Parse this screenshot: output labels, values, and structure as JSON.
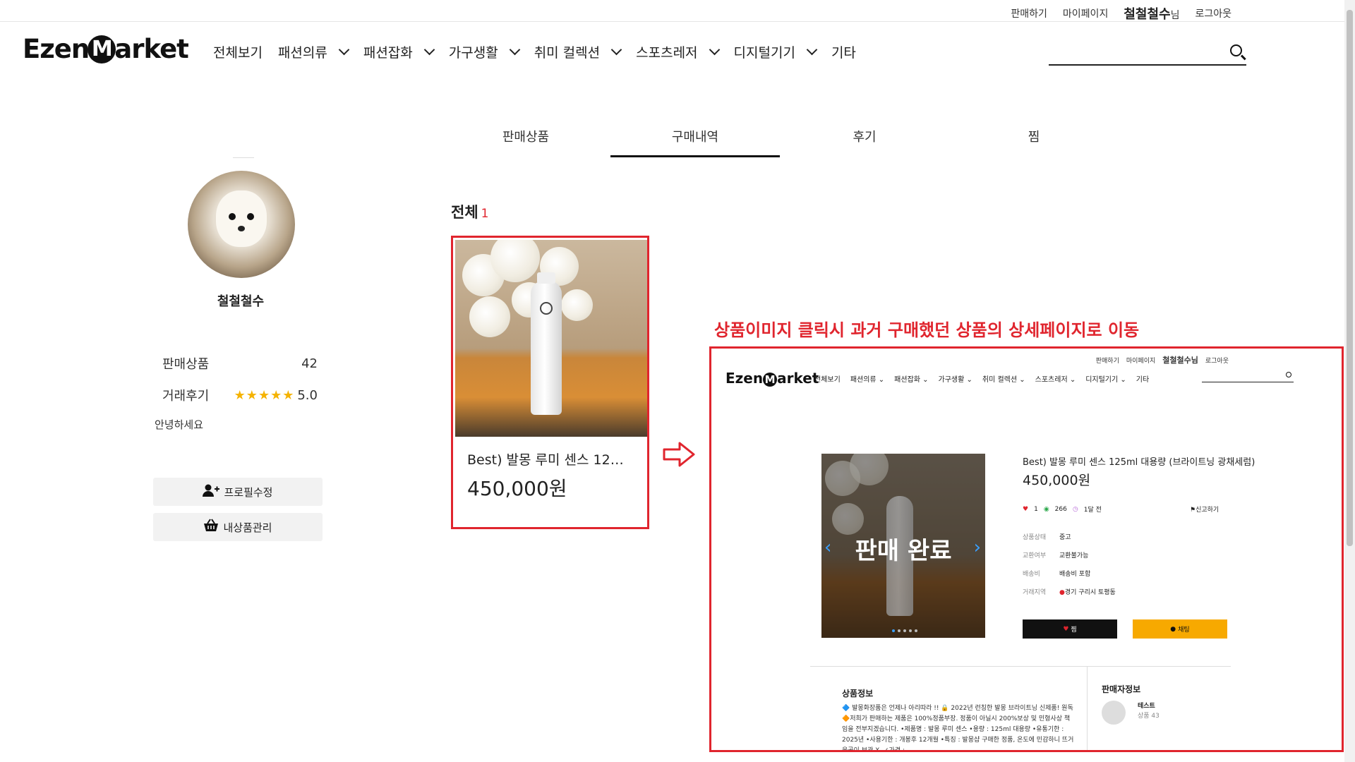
{
  "topbar": {
    "sell": "판매하기",
    "mypage": "마이페이지",
    "username": "철철철수",
    "nim": "님",
    "logout": "로그아웃"
  },
  "header": {
    "logo": {
      "pre": "Ezen",
      "m": "M",
      "post": "arket"
    },
    "nav": [
      "전체보기",
      "패션의류",
      "패션잡화",
      "가구생활",
      "취미 컬렉션",
      "스포츠레저",
      "디지털기기",
      "기타"
    ],
    "nav_has_chevron": [
      false,
      true,
      true,
      true,
      true,
      true,
      true,
      false
    ],
    "search_placeholder": ""
  },
  "tabs": [
    "판매상품",
    "구매내역",
    "후기",
    "찜"
  ],
  "active_tab": "구매내역",
  "profile": {
    "name": "철철철수",
    "stat_sales_label": "판매상품",
    "stat_sales_value": "42",
    "stat_review_label": "거래후기",
    "stars": "★★★★★",
    "rating": "5.0",
    "intro": "안녕하세요",
    "edit_button": "프로필수정",
    "manage_button": "내상품관리"
  },
  "purchases": {
    "total_label": "전체",
    "total_count": "1",
    "items": [
      {
        "title": "Best) 발몽 루미 센스 12…",
        "price": "450,000원"
      }
    ]
  },
  "annotation": "상품이미지 클릭시 과거 구매했던 상품의 상세페이지로 이동",
  "preview": {
    "top": {
      "sell": "판매하기",
      "mypage": "마이페이지",
      "username": "철철철수님",
      "logout": "로그아웃"
    },
    "logo": {
      "pre": "Ezen",
      "m": "M",
      "post": "arket"
    },
    "nav": [
      "전체보기",
      "패션의류 ⌄",
      "패션잡화 ⌄",
      "가구생활 ⌄",
      "취미 컬렉션 ⌄",
      "스포츠레저 ⌄",
      "디지털기기 ⌄",
      "기타"
    ],
    "sold_overlay": "판매 완료",
    "title": "Best) 발몽 루미 센스 125ml 대용량 (브라이트닝 광채세럼)",
    "price": "450,000원",
    "meta": {
      "likes": "1",
      "views": "266",
      "time": "1달 전"
    },
    "report": "신고하기",
    "rows": [
      {
        "k": "상품상태",
        "v": "중고"
      },
      {
        "k": "교환여부",
        "v": "교환불가능"
      },
      {
        "k": "배송비",
        "v": "배송비 포함"
      },
      {
        "k": "거래지역",
        "v": "경기 구리시 토평동"
      }
    ],
    "like_btn": "찜",
    "chat_btn": "채팅",
    "product_info_title": "상품정보",
    "product_info_text": "🔷 발몽화장품은 언제나 아리따라 !! 🔒 2022년 런칭한 발몽 브라이트닝 신제품! 원독🔶저희가 판매하는 제품은 100%정품부장. 정품이 아닐시 200%보상 및 민형사상 책임을 전부지겠습니다. •제품명 : 발몽 루미 센스 •용량 : 125ml 대용량 •유통기한 : 2025년 •사용기한 : 개봉후 12개월 •특징 : 발몽샵 구매한 정품, 온도에 민감하니 뜨거운곳이 보관 X. ✓가격 :",
    "seller_title": "판매자정보",
    "seller_name": "테스트",
    "seller_count": "상품 43"
  },
  "colors": {
    "accent": "#e0252e",
    "star": "#f5b301",
    "chat": "#f7a900"
  }
}
